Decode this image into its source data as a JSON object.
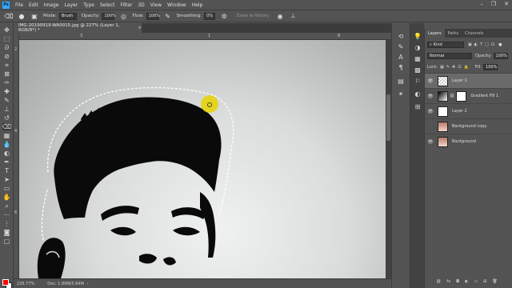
{
  "menubar": {
    "logo": "Ps",
    "items": [
      "File",
      "Edit",
      "Image",
      "Layer",
      "Type",
      "Select",
      "Filter",
      "3D",
      "View",
      "Window",
      "Help"
    ],
    "window_controls": [
      "–",
      "❐",
      "✕"
    ]
  },
  "options": {
    "mode_label": "Mode:",
    "mode_value": "Brush",
    "opacity_label": "Opacity:",
    "opacity_value": "100%",
    "flow_label": "Flow:",
    "flow_value": "100%",
    "smoothing_label": "Smoothing:",
    "smoothing_value": "0%",
    "erase_history_label": "Erase to History"
  },
  "document": {
    "tab_title": "IMG-20190919-WA0015.jpg @ 227% (Layer 1, RGB/8*) *",
    "zoom": "226.77%",
    "doc_info": "Doc: 1.89M/5.64M"
  },
  "rulers": {
    "h_labels": [
      "3",
      "1",
      "8"
    ],
    "v_labels": [
      "2",
      "4",
      "6"
    ]
  },
  "layers_panel": {
    "tabs": [
      "Layers",
      "Paths",
      "Channels"
    ],
    "filter_value": "Kind",
    "blend_value": "Normal",
    "opacity_label": "Opacity:",
    "opacity_value": "100%",
    "lock_label": "Lock:",
    "fill_label": "Fill:",
    "fill_value": "100%",
    "layers": [
      {
        "name": "Layer 1",
        "visible": true,
        "selected": true
      },
      {
        "name": "Gradient Fill 1",
        "visible": true,
        "selected": false
      },
      {
        "name": "Layer 2",
        "visible": true,
        "selected": false
      },
      {
        "name": "Background copy",
        "visible": false,
        "selected": false
      },
      {
        "name": "Background",
        "visible": true,
        "selected": false
      }
    ]
  },
  "colors": {
    "foreground": "#ff0000",
    "background": "#ffffff",
    "cursor_highlight": "#e6d400"
  },
  "icons": [
    "eraser-icon",
    "brush-preset-icon",
    "airbrush-icon",
    "pressure-icon",
    "symmetry-icon",
    "move-icon",
    "marquee-icon",
    "lasso-icon",
    "crop-icon",
    "eyedropper-icon",
    "healing-icon",
    "brush-icon",
    "stamp-icon",
    "history-brush-icon",
    "eraser-tool-icon",
    "gradient-icon",
    "blur-icon",
    "dodge-icon",
    "pen-icon",
    "type-icon",
    "path-select-icon",
    "shape-icon",
    "hand-icon",
    "zoom-icon",
    "eye-icon"
  ]
}
